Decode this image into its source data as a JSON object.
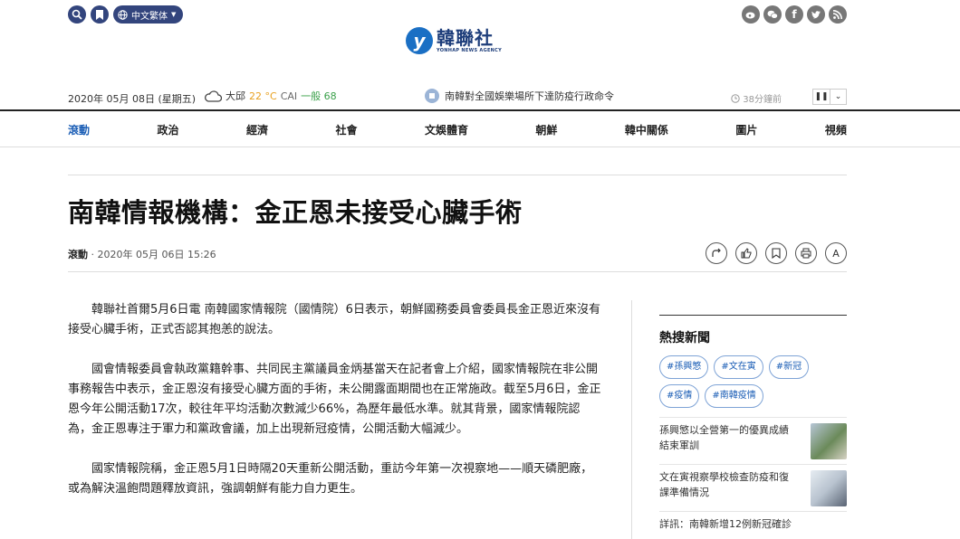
{
  "topbar": {
    "lang_label": "中文繁体",
    "icons_left": [
      "search-icon",
      "bookmark-icon",
      "globe-icon"
    ],
    "social": [
      "weibo-icon",
      "wechat-icon",
      "facebook-icon",
      "twitter-icon",
      "rss-icon"
    ]
  },
  "logo": {
    "mark": "y",
    "main": "韓聯社",
    "sub": "YONHAP NEWS AGENCY"
  },
  "infobar": {
    "date": "2020年 05月 08日 (星期五)",
    "city": "大邱",
    "temp": "22 °C",
    "cai_label": "CAI",
    "cai_value": "一般 68",
    "ticker": "南韓對全國娛樂場所下達防疫行政命令",
    "ticker_time": "38分鐘前",
    "pause": "❚❚",
    "down": "⌄"
  },
  "nav": [
    "滾動",
    "政治",
    "經濟",
    "社會",
    "文娛體育",
    "朝鮮",
    "韓中關係",
    "圖片",
    "視頻"
  ],
  "article": {
    "headline": "南韓情報機構：金正恩未接受心臟手術",
    "section": "滾動",
    "datetime": "· 2020年 05月 06日 15:26",
    "paragraphs": [
      "韓聯社首爾5月6日電 南韓國家情報院（國情院）6日表示，朝鮮國務委員會委員長金正恩近來沒有接受心臟手術，正式否認其抱恙的說法。",
      "國會情報委員會執政黨籍幹事、共同民主黨議員金炳基當天在記者會上介紹，國家情報院在非公開事務報告中表示，金正恩沒有接受心臟方面的手術，未公開露面期間也在正常施政。截至5月6日，金正恩今年公開活動17次，較往年平均活動次數減少66%，為歷年最低水準。就其背景，國家情報院認為，金正恩專注于軍力和黨政會議，加上出現新冠疫情，公開活動大幅減少。",
      "國家情報院稱，金正恩5月1日時隔20天重新公開活動，重訪今年第一次視察地——順天磷肥廠，或為解決溫飽問題釋放資訊，強調朝鮮有能力自力更生。"
    ]
  },
  "tools": {
    "font_label": "A"
  },
  "sidebar": {
    "title": "熱搜新聞",
    "tags": [
      "#孫興慜",
      "#文在寅",
      "#新冠",
      "#疫情",
      "#南韓疫情"
    ],
    "news": [
      {
        "title": "孫興慜以全營第一的優異成績結束軍訓"
      },
      {
        "title": "文在寅視察學校檢查防疫和復課準備情況"
      },
      {
        "title": "詳訊：南韓新增12例新冠確診"
      }
    ]
  },
  "colors": {
    "brand": "#33457d",
    "active_nav": "#1a5db5",
    "tag": "#1a5db5"
  }
}
